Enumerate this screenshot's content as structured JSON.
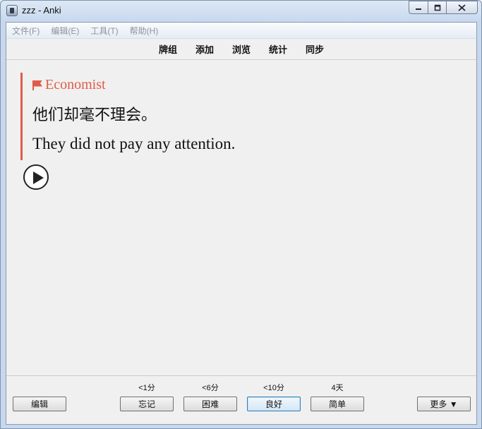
{
  "window": {
    "title": "zzz - Anki",
    "app_icon": "anki-icon"
  },
  "caption_buttons": {
    "minimize": "minimize-icon",
    "maximize": "maximize-icon",
    "close": "close-icon"
  },
  "menu": {
    "items": [
      "文件(F)",
      "编辑(E)",
      "工具(T)",
      "帮助(H)"
    ]
  },
  "toolbar": {
    "links": [
      "牌组",
      "添加",
      "浏览",
      "统计",
      "同步"
    ]
  },
  "card": {
    "source": "Economist",
    "chinese": "他们却毫不理会。",
    "english": "They did not pay any attention.",
    "accent_color": "#e05c46",
    "audio_icon": "play-icon"
  },
  "bottom": {
    "edit_label": "编辑",
    "more_label": "更多 ▼",
    "answers": [
      {
        "label": "忘记",
        "interval": "<1分"
      },
      {
        "label": "困难",
        "interval": "<6分"
      },
      {
        "label": "良好",
        "interval": "<10分"
      },
      {
        "label": "简单",
        "interval": "4天"
      }
    ]
  }
}
